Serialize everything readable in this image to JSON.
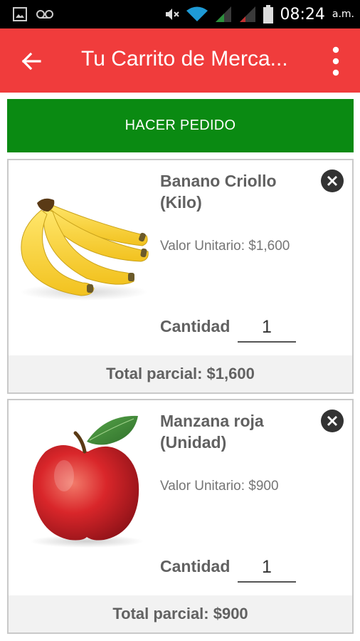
{
  "status_bar": {
    "time": "08:24",
    "ampm": "a.m.",
    "icons": [
      "image-icon",
      "voicemail-icon",
      "mute-icon",
      "wifi-icon",
      "signal-icon",
      "signal-icon",
      "battery-icon"
    ]
  },
  "app_bar": {
    "title": "Tu Carrito de Merca...",
    "background_color": "#f03c3c",
    "back_icon": "arrow-left-icon",
    "menu_icon": "more-vert-icon"
  },
  "order_button": {
    "label": "HACER PEDIDO",
    "color": "#0a8a12"
  },
  "cart_items": [
    {
      "name": "Banano Criollo (Kilo)",
      "unit_price": "Valor Unitario: $1,600",
      "quantity_label": "Cantidad",
      "quantity": "1",
      "subtotal": "Total parcial: $1,600",
      "image": "banana-bunch-image"
    },
    {
      "name": "Manzana roja (Unidad)",
      "unit_price": "Valor Unitario: $900",
      "quantity_label": "Cantidad",
      "quantity": "1",
      "subtotal": "Total parcial: $900",
      "image": "red-apple-image"
    }
  ]
}
